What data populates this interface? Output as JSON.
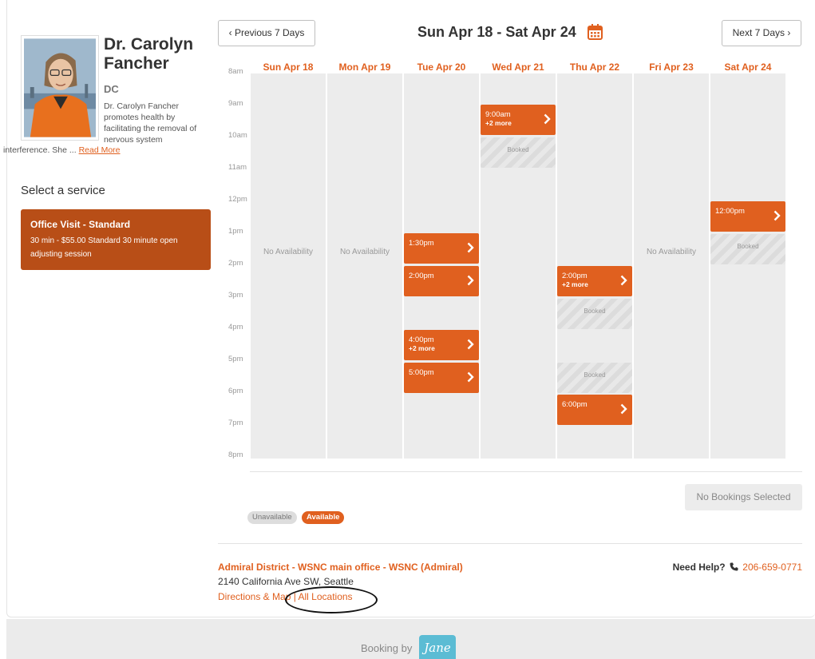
{
  "provider": {
    "name": "Dr. Carolyn Fancher",
    "credentials": "DC",
    "bio_part1": "Dr. Carolyn Fancher promotes health by facilitating the removal of nervous system",
    "bio_part2": "interference. She ...",
    "read_more": "Read More"
  },
  "service_section": {
    "title": "Select a service",
    "selected_service": {
      "name": "Office Visit - Standard",
      "description": "30 min - $55.00 Standard 30 minute open adjusting session"
    }
  },
  "nav": {
    "prev_label": "Previous 7 Days",
    "next_label": "Next 7 Days",
    "range_title": "Sun Apr 18 - Sat Apr 24",
    "calendar_icon": "calendar-icon"
  },
  "calendar": {
    "times": [
      "8am",
      "9am",
      "10am",
      "11am",
      "12pm",
      "1pm",
      "2pm",
      "3pm",
      "4pm",
      "5pm",
      "6pm",
      "7pm",
      "8pm"
    ],
    "days": [
      {
        "label": "Sun Apr 18",
        "no_availability": "No Availability"
      },
      {
        "label": "Mon Apr 19",
        "no_availability": "No Availability"
      },
      {
        "label": "Tue Apr 20"
      },
      {
        "label": "Wed Apr 21"
      },
      {
        "label": "Thu Apr 22"
      },
      {
        "label": "Fri Apr 23",
        "no_availability": "No Availability"
      },
      {
        "label": "Sat Apr 24"
      }
    ],
    "slots": {
      "tue_1": {
        "time": "1:30pm"
      },
      "tue_2": {
        "time": "2:00pm"
      },
      "tue_3": {
        "time": "4:00pm",
        "more": "+2 more"
      },
      "tue_4": {
        "time": "5:00pm"
      },
      "wed_1": {
        "time": "9:00am",
        "more": "+2 more"
      },
      "thu_1": {
        "time": "2:00pm",
        "more": "+2 more"
      },
      "thu_2": {
        "time": "6:00pm"
      },
      "sat_1": {
        "time": "12:00pm"
      }
    },
    "booked_label": "Booked"
  },
  "summary": {
    "no_bookings": "No Bookings Selected"
  },
  "legend": {
    "unavailable": "Unavailable",
    "available": "Available"
  },
  "location": {
    "name": "Admiral District - WSNC main office - WSNC (Admiral)",
    "address": "2140 California Ave SW, Seattle",
    "directions": "Directions & Map",
    "separator": " | ",
    "all_locations": "All Locations"
  },
  "help": {
    "label": "Need Help?",
    "phone": "206-659-0771"
  },
  "footer": {
    "booking_by": "Booking by",
    "brand": "Jane"
  },
  "colors": {
    "accent": "#e0601f",
    "service_bg": "#b84e17",
    "column_bg": "#ececec",
    "brand_badge": "#5bbcd4"
  }
}
